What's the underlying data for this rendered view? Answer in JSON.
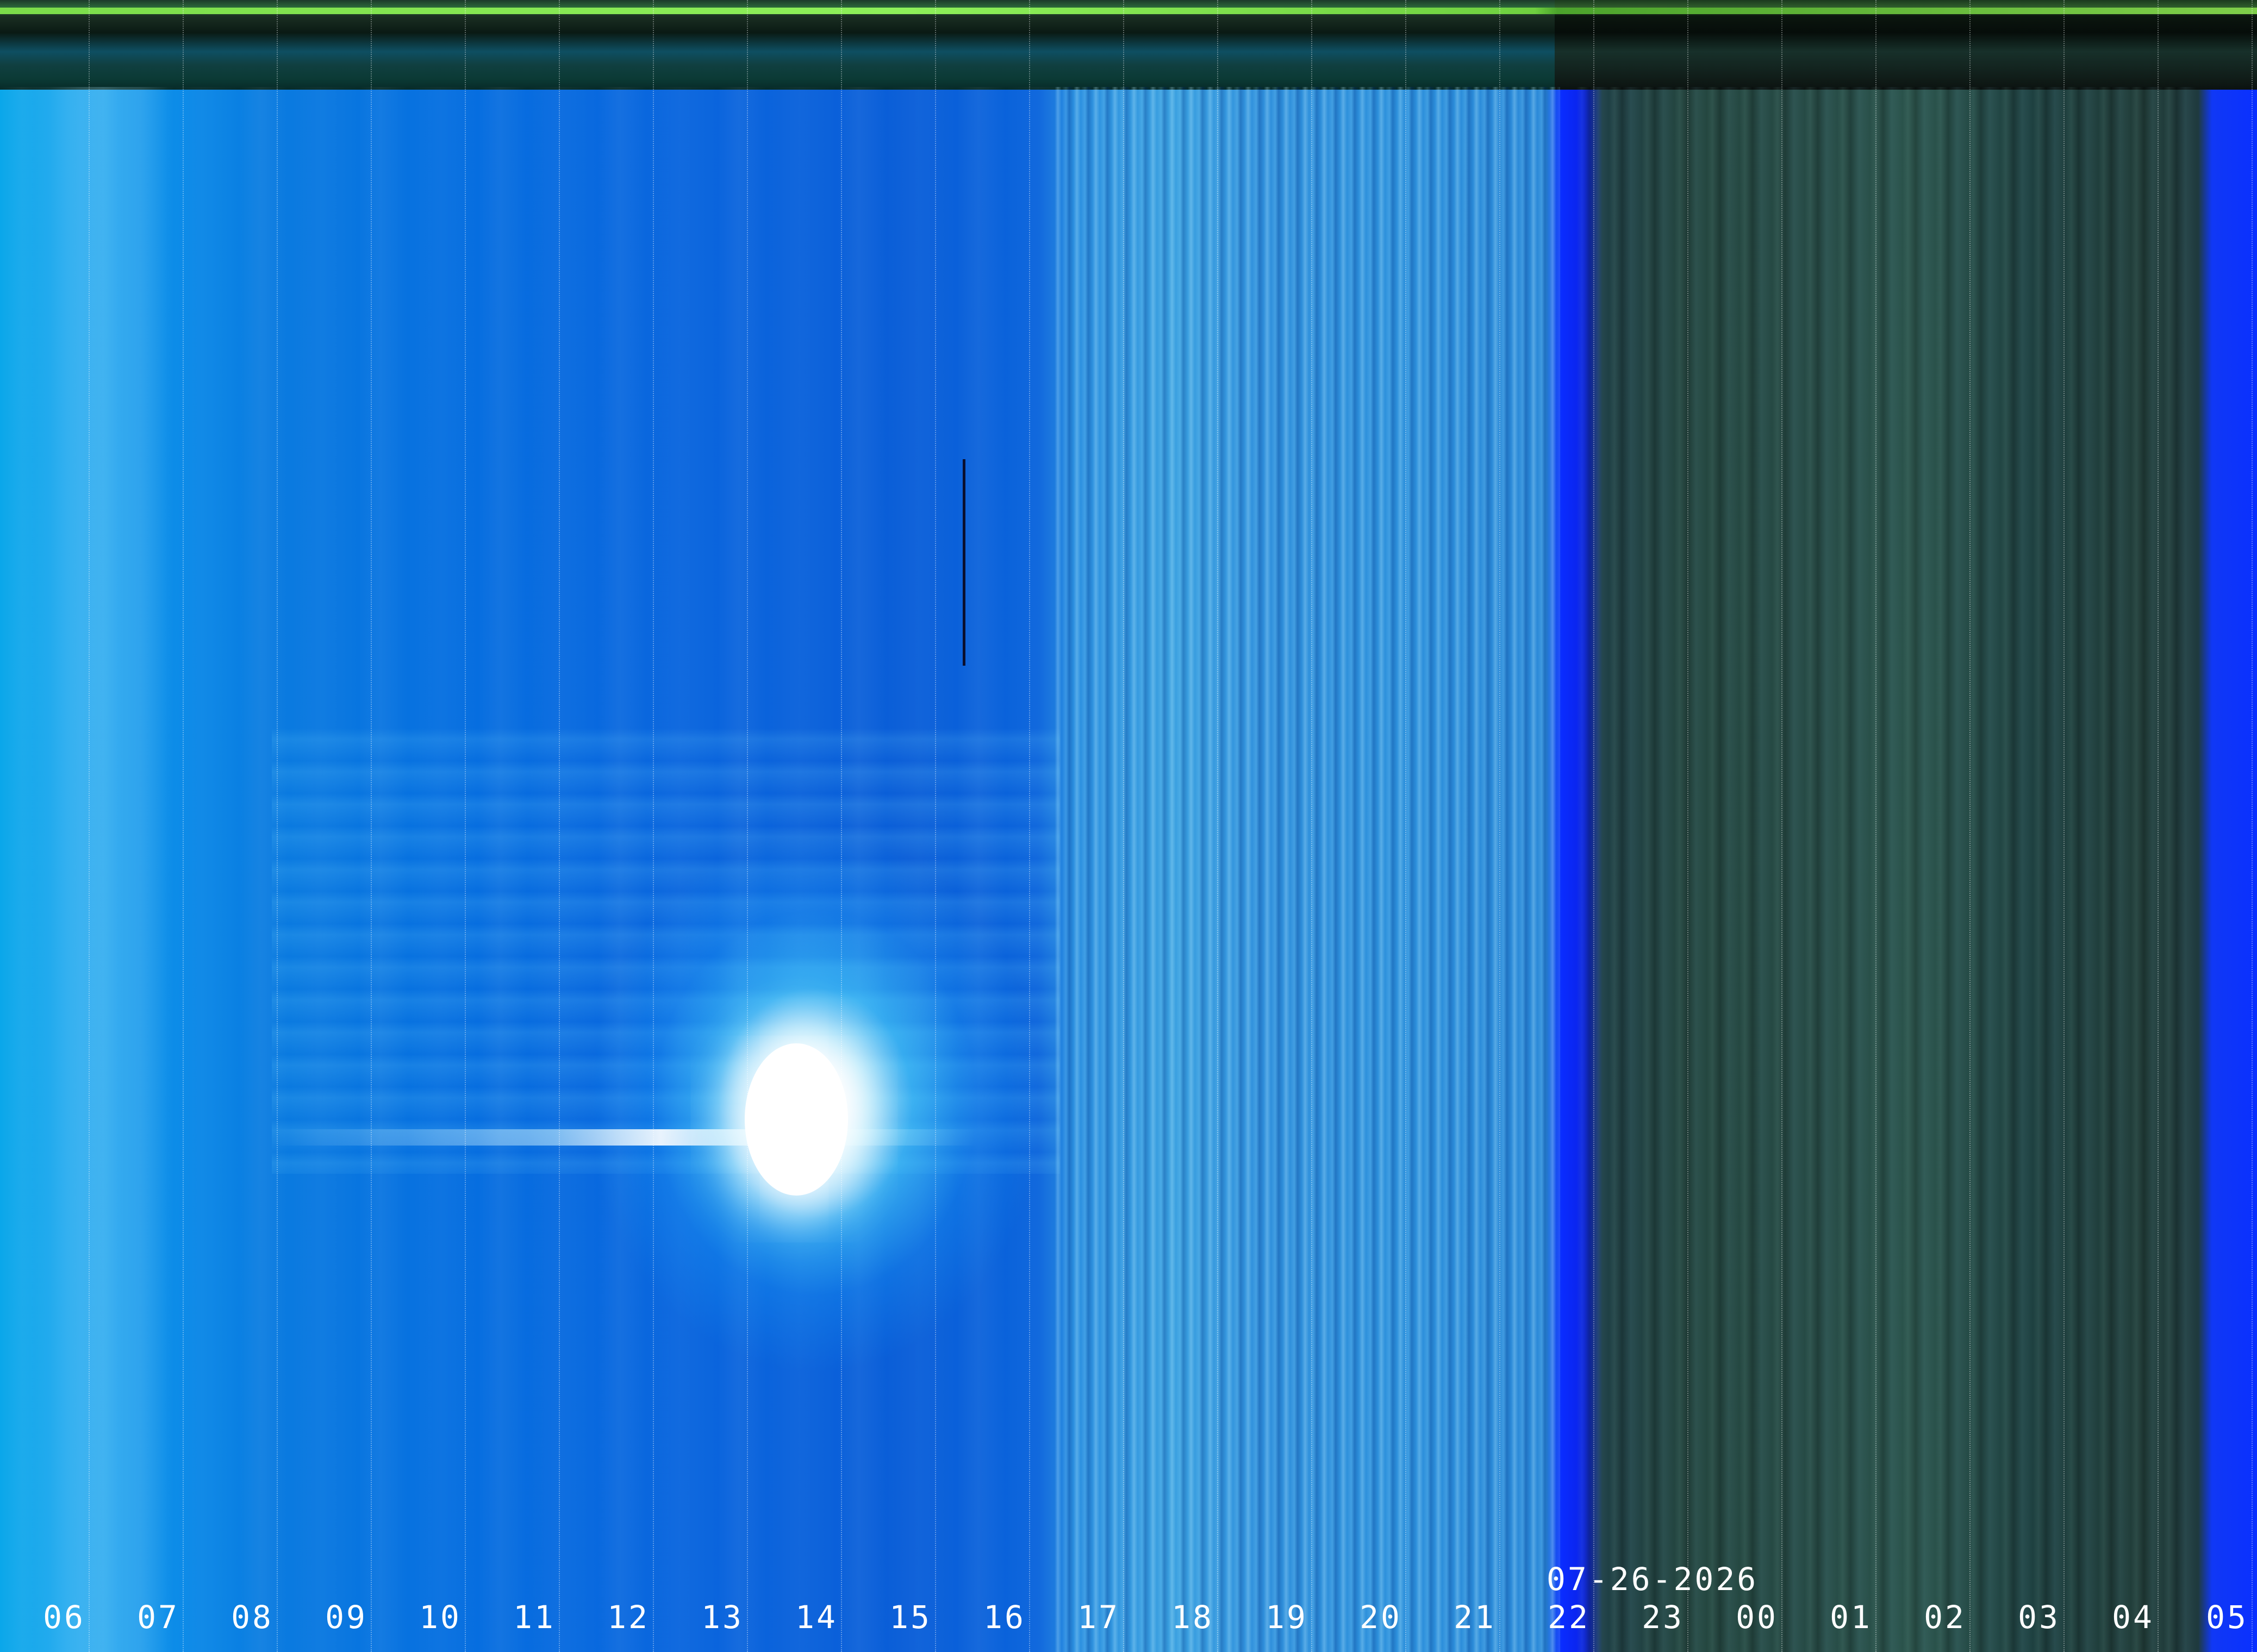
{
  "date": "07-26-2026",
  "hour_labels": [
    "06",
    "07",
    "08",
    "09",
    "10",
    "11",
    "12",
    "13",
    "14",
    "15",
    "16",
    "17",
    "18",
    "19",
    "20",
    "21",
    "22",
    "23",
    "00",
    "01",
    "02",
    "03",
    "04",
    "05"
  ],
  "colors": {
    "day_sky": "#0a66de",
    "cloud_band": "#2f8fdc",
    "night_sky": "#24463f",
    "top_status_line": "#7bdc4a",
    "label_text": "#ffffff"
  }
}
